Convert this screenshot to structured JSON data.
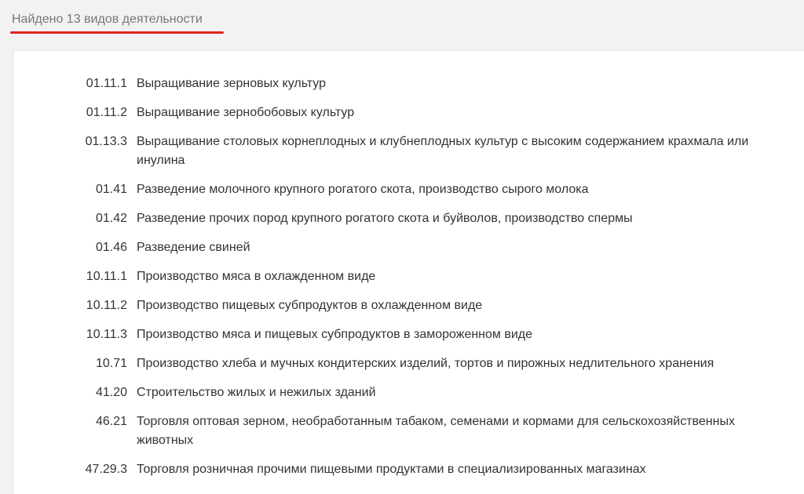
{
  "header": {
    "title": "Найдено 13 видов деятельности",
    "underline_color": "#e0251b"
  },
  "activities": [
    {
      "code": "01.11.1",
      "name": "Выращивание зерновых культур"
    },
    {
      "code": "01.11.2",
      "name": "Выращивание зернобобовых культур"
    },
    {
      "code": "01.13.3",
      "name": "Выращивание столовых корнеплодных и клубнеплодных культур с высоким содержанием крахмала или инулина"
    },
    {
      "code": "01.41",
      "name": "Разведение молочного крупного рогатого скота, производство сырого молока"
    },
    {
      "code": "01.42",
      "name": "Разведение прочих пород крупного рогатого скота и буйволов, производство спермы"
    },
    {
      "code": "01.46",
      "name": "Разведение свиней"
    },
    {
      "code": "10.11.1",
      "name": "Производство мяса в охлажденном виде"
    },
    {
      "code": "10.11.2",
      "name": "Производство пищевых субпродуктов в охлажденном виде"
    },
    {
      "code": "10.11.3",
      "name": "Производство мяса и пищевых субпродуктов в замороженном виде"
    },
    {
      "code": "10.71",
      "name": "Производство хлеба и мучных кондитерских изделий, тортов и пирожных недлительного хранения"
    },
    {
      "code": "41.20",
      "name": "Строительство жилых и нежилых зданий"
    },
    {
      "code": "46.21",
      "name": "Торговля оптовая зерном, необработанным табаком, семенами и кормами для сельскохозяйственных животных"
    },
    {
      "code": "47.29.3",
      "name": "Торговля розничная прочими пищевыми продуктами в специализированных магазинах"
    }
  ]
}
